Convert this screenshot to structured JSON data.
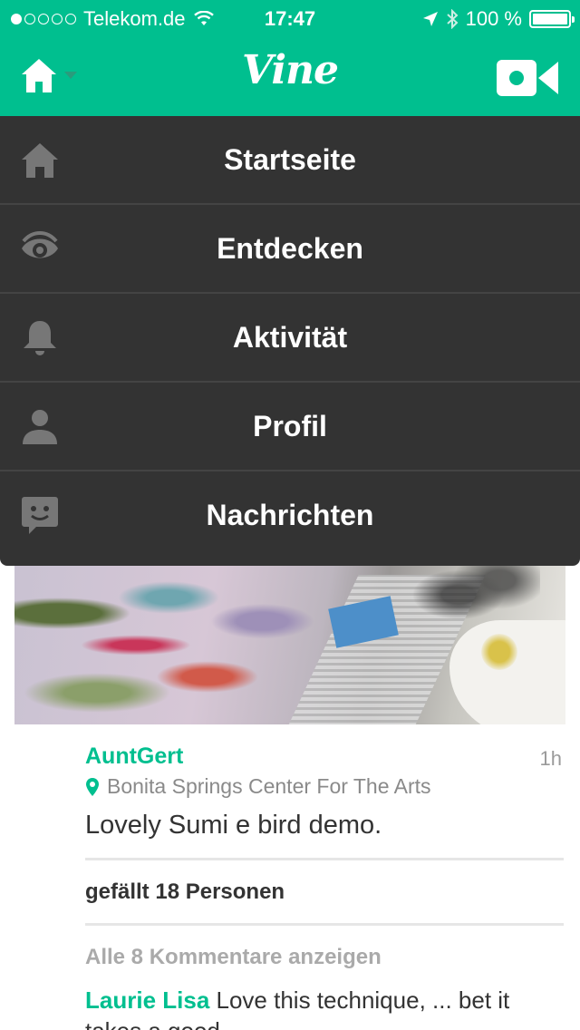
{
  "status_bar": {
    "carrier": "Telekom.de",
    "time": "17:47",
    "battery": "100 %",
    "signal_bars_filled": 1,
    "signal_bars_total": 5
  },
  "nav": {
    "logo": "Vine",
    "home_icon": "home-icon",
    "camera_icon": "video-camera-icon"
  },
  "menu": {
    "items": [
      {
        "label": "Startseite",
        "icon": "home-icon"
      },
      {
        "label": "Entdecken",
        "icon": "eye-icon"
      },
      {
        "label": "Aktivität",
        "icon": "bell-icon"
      },
      {
        "label": "Profil",
        "icon": "person-icon"
      },
      {
        "label": "Nachrichten",
        "icon": "chat-face-icon"
      }
    ]
  },
  "post": {
    "author": "AuntGert",
    "time_ago": "1h",
    "location": "Bonita Springs Center For The Arts",
    "caption": "Lovely Sumi e bird demo.",
    "likes": "gefällt 18 Personen",
    "comments_link": "Alle 8 Kommentare anzeigen",
    "comment": {
      "author": "Laurie Lisa",
      "text": "Love this technique, ... bet it takes a good"
    }
  },
  "colors": {
    "brand": "#00bf8f",
    "menu_bg": "#333333"
  }
}
